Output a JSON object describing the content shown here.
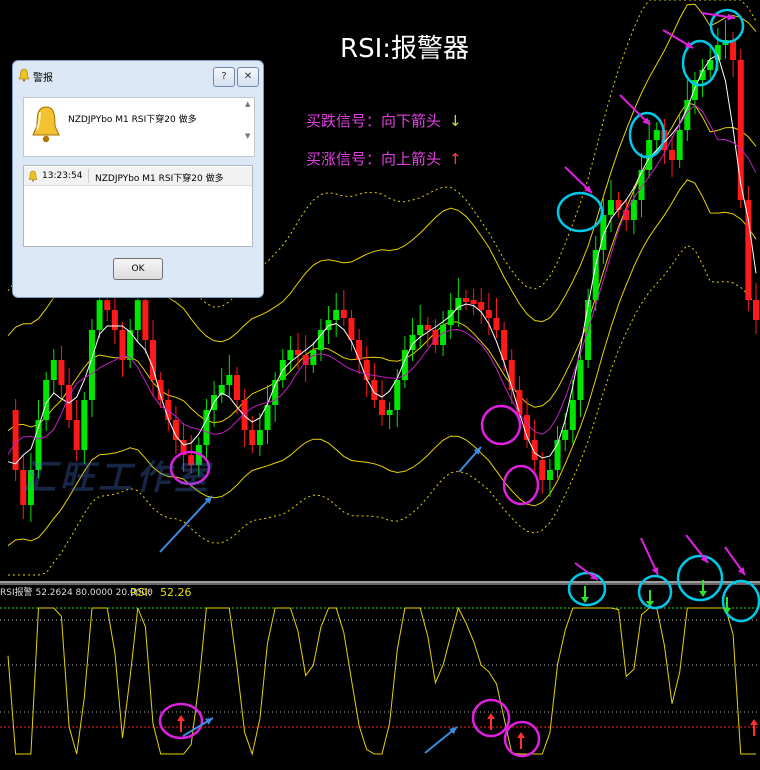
{
  "chart": {
    "title": "RSI:报警器",
    "legend_down_text": "买跌信号：向下箭头",
    "legend_down_arrow": "↓",
    "legend_up_text": "买涨信号：向上箭头",
    "legend_up_arrow": "↑",
    "watermark": "汇旺工作室",
    "colors": {
      "background": "#000000",
      "bull_candle": "#00e600",
      "bear_candle": "#ff1a1a",
      "bollinger": "#e6d200",
      "ma_fast": "#ffffff",
      "ma_slow": "#c020c0",
      "rsi_line": "#e6d200",
      "signal_circle": "#00c8e8",
      "highlight_circle": "#e020e0",
      "pointer_arrow_blue": "#3c8ce0",
      "pointer_arrow_magenta": "#e020e0",
      "rsi_overbought_line": "#20e020",
      "rsi_oversold_line": "#ff2020"
    }
  },
  "indicator": {
    "header_text": "RSI报警 52.2624 80.0000 20.0000",
    "value_label": "RSI:",
    "value": "52.26",
    "levels": [
      80,
      20
    ],
    "current": 52.2624
  },
  "dialog": {
    "title": "警报",
    "help_button": "?",
    "close_button": "✕",
    "message": "NZDJPYbo M1 RSI下穿20 做多",
    "list_rows": [
      {
        "time": "13:23:54",
        "message": "NZDJPYbo M1 RSI下穿20 做多"
      }
    ],
    "ok_label": "OK"
  }
}
